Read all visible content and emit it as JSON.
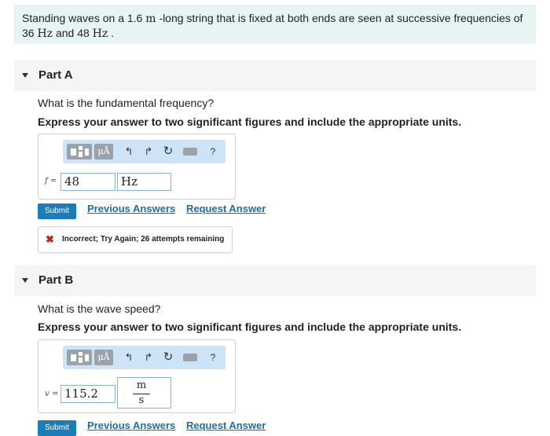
{
  "problem": {
    "text_before": "Standing waves on a 1.6 ",
    "unit_m": "m",
    "text_mid": " -long string that is fixed at both ends are seen at successive frequencies of 36 ",
    "unit_hz1": "Hz",
    "text_and": " and 48 ",
    "unit_hz2": "Hz",
    "text_end": " ."
  },
  "toolbar": {
    "units_label": "μÅ",
    "undo_icon": "↰",
    "redo_icon": "↱",
    "reset_icon": "↻",
    "help_label": "?"
  },
  "part_a": {
    "title": "Part A",
    "question": "What is the fundamental frequency?",
    "instruction": "Express your answer to two significant figures and include the appropriate units.",
    "variable": "f =",
    "value": "48",
    "unit": "Hz",
    "submit_label": "Submit",
    "previous_answers_label": "Previous Answers",
    "request_answer_label": "Request Answer",
    "feedback_icon": "✖",
    "feedback_text": "Incorrect; Try Again; 26 attempts remaining"
  },
  "part_b": {
    "title": "Part B",
    "question": "What is the wave speed?",
    "instruction": "Express your answer to two significant figures and include the appropriate units.",
    "variable": "v =",
    "value": "115.2",
    "unit_numerator": "m",
    "unit_denominator": "s",
    "submit_label": "Submit",
    "previous_answers_label": "Previous Answers",
    "request_answer_label": "Request Answer"
  },
  "colors": {
    "problem_bg": "#e6f4f4",
    "toolbar_bg": "#cde4f7",
    "submit_bg": "#1b7db7",
    "link": "#1b6fa8",
    "error": "#d0201a"
  }
}
